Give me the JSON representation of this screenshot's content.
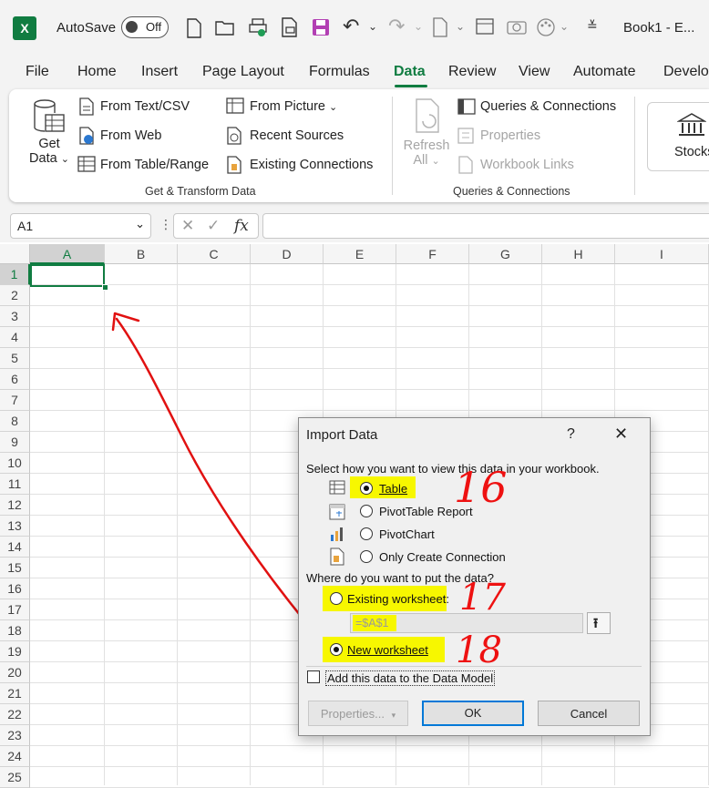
{
  "titlebar": {
    "autosave_label": "AutoSave",
    "autosave_state": "Off",
    "book_title": "Book1 - E..."
  },
  "tabs": [
    "File",
    "Home",
    "Insert",
    "Page Layout",
    "Formulas",
    "Data",
    "Review",
    "View",
    "Automate",
    "Develo"
  ],
  "active_tab": "Data",
  "ribbon": {
    "get_data_line1": "Get",
    "get_data_line2": "Data",
    "from_text_csv": "From Text/CSV",
    "from_web": "From Web",
    "from_table_range": "From Table/Range",
    "from_picture": "From Picture",
    "recent_sources": "Recent Sources",
    "existing_connections": "Existing Connections",
    "group1_label": "Get & Transform Data",
    "refresh_line1": "Refresh",
    "refresh_line2": "All",
    "queries_connections": "Queries & Connections",
    "properties": "Properties",
    "workbook_links": "Workbook Links",
    "group2_label": "Queries & Connections",
    "stocks": "Stocks"
  },
  "formula_bar": {
    "name_box": "A1",
    "cancel_glyph": "✕",
    "enter_glyph": "✓",
    "fx_label": "fx",
    "formula_value": ""
  },
  "grid": {
    "columns": [
      "A",
      "B",
      "C",
      "D",
      "E",
      "F",
      "G",
      "H",
      "I"
    ],
    "rows": [
      "1",
      "2",
      "3",
      "4",
      "5",
      "6",
      "7",
      "8",
      "9",
      "10",
      "11",
      "12",
      "13",
      "14",
      "15",
      "16",
      "17",
      "18",
      "19",
      "20",
      "21",
      "22",
      "23",
      "24",
      "25"
    ],
    "selected_cell": "A1"
  },
  "dialog": {
    "title": "Import Data",
    "help": "?",
    "close": "✕",
    "view_prompt": "Select how you want to view this data in your workbook.",
    "opt_table": "Table",
    "opt_pivottable": "PivotTable Report",
    "opt_pivotchart": "PivotChart",
    "opt_connection": "Only Create Connection",
    "put_prompt": "Where do you want to put the data?",
    "opt_existing": "Existing worksheet:",
    "existing_ref": "=$A$1",
    "opt_new": "New worksheet",
    "data_model": "Add this data to the Data Model",
    "btn_properties": "Properties...",
    "btn_ok": "OK",
    "btn_cancel": "Cancel"
  },
  "annotations": {
    "n16": "16",
    "n17": "17",
    "n18": "18",
    "color": "#e11111"
  }
}
